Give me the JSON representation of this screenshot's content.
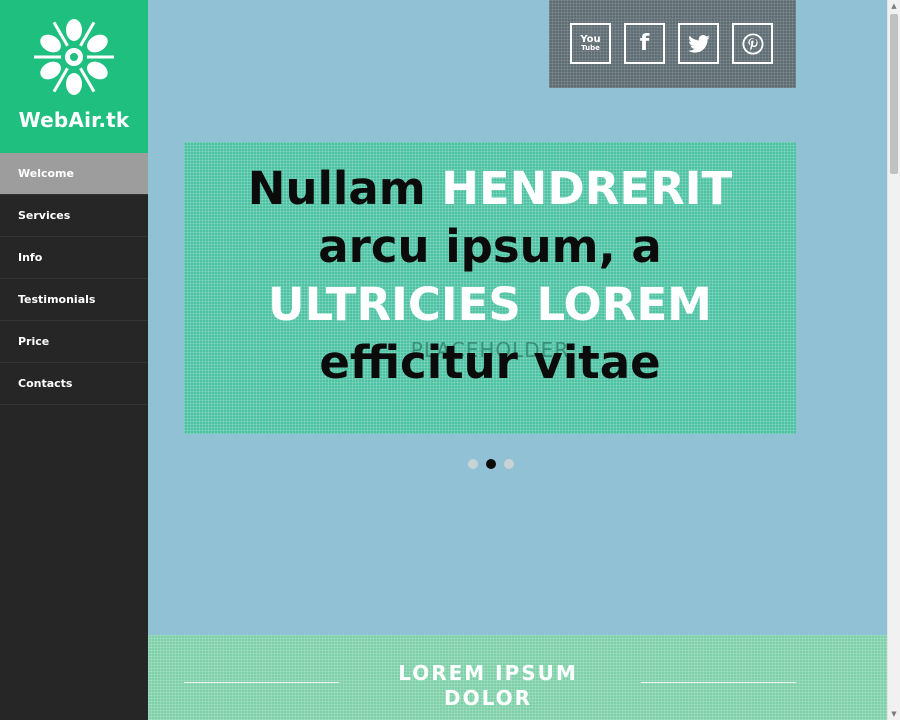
{
  "brand": {
    "name": "WebAir.tk"
  },
  "nav": {
    "items": [
      {
        "label": "Welcome",
        "active": true
      },
      {
        "label": "Services"
      },
      {
        "label": "Info"
      },
      {
        "label": "Testimonials"
      },
      {
        "label": "Price"
      },
      {
        "label": "Contacts"
      }
    ]
  },
  "social": {
    "youtube": {
      "icon": "youtube-icon",
      "top": "You",
      "bottom": "Tube"
    },
    "facebook": {
      "icon": "facebook-icon",
      "glyph": "f"
    },
    "twitter": {
      "icon": "twitter-icon"
    },
    "pinterest": {
      "icon": "pinterest-icon"
    }
  },
  "hero": {
    "line1_a": "Nullam ",
    "line1_b": "HENDRERIT",
    "line2": "arcu ipsum, a",
    "line3": "ULTRICIES LOREM",
    "line4": "efficitur vitae",
    "placeholder": "PLACEHOLDER"
  },
  "slider": {
    "count": 3,
    "active": 2
  },
  "section": {
    "title_line1": "LOREM IPSUM",
    "title_line2": "DOLOR"
  },
  "colors": {
    "brand_green": "#1fbf80",
    "sidebar_dark": "#262626",
    "page_blue": "#91c1d5",
    "hero_teal": "#4ec3a3",
    "section_green": "#7ed0a8"
  }
}
